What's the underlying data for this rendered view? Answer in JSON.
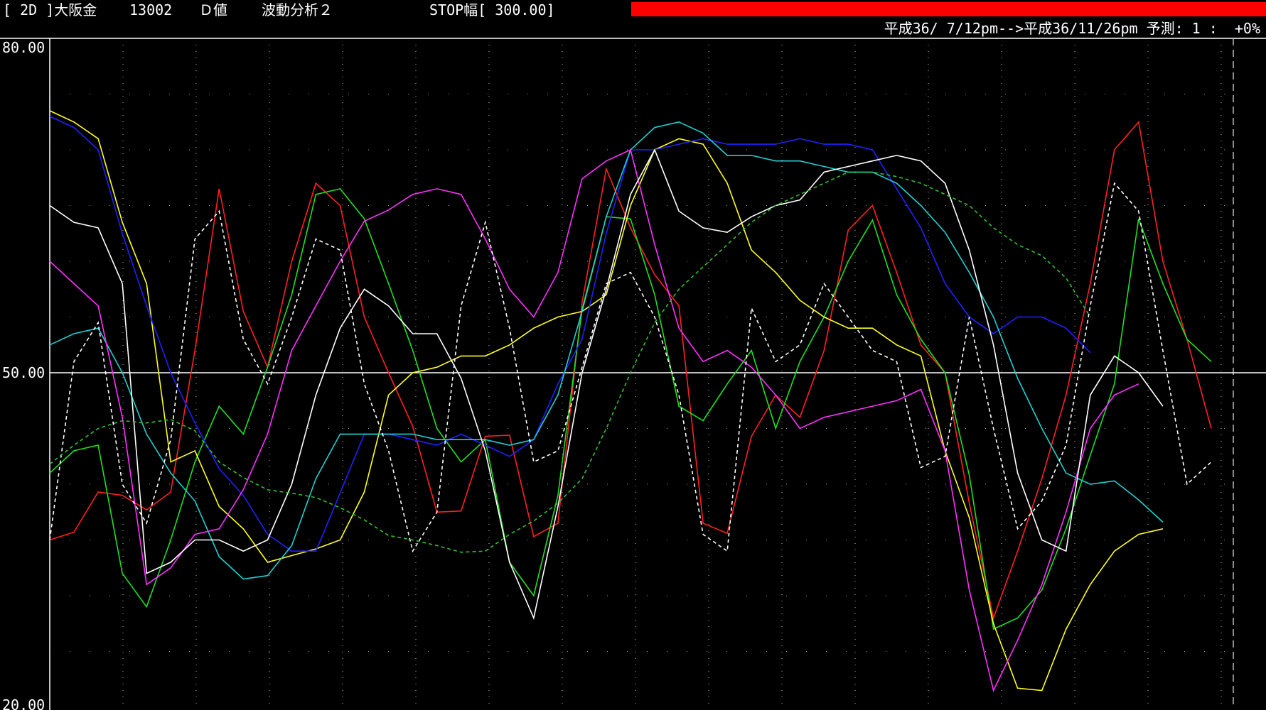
{
  "header": {
    "code_label": "[ 2D ]大阪金",
    "code_number": "13002",
    "mode": "Ｄ値",
    "analysis": "波動分析２",
    "stop_label": "STOP幅[ 300.00]",
    "stop_color": "#ff0000"
  },
  "subheader": {
    "range_text": "平成36/ 7/12pm-->平成36/11/26pm 予測: 1 :  +0%"
  },
  "chart_data": {
    "type": "line",
    "ylim": [
      20,
      80
    ],
    "yticks": [
      "80.00",
      "50.00",
      "20.00"
    ],
    "reference_line": 50,
    "grid": "dotted",
    "n_points": 50,
    "series": [
      {
        "color": "#ff2020",
        "dash": false,
        "values": [
          35,
          35.7,
          39.3,
          39,
          37.7,
          39.3,
          52,
          66.5,
          55.5,
          50.5,
          60,
          67,
          65,
          55,
          50,
          45.2,
          37.5,
          37.6,
          44.3,
          44.4,
          35.3,
          36.5,
          56.3,
          68.3,
          63,
          58.8,
          56,
          36.5,
          35.6,
          44.3,
          48,
          46,
          52,
          62.8,
          65,
          59,
          52.5,
          50,
          38.3,
          28,
          34,
          40.5,
          48,
          58,
          70,
          72.5,
          60,
          53,
          45
        ]
      },
      {
        "color": "#20e020",
        "dash": false,
        "values": [
          41,
          43,
          43.5,
          32,
          29,
          35,
          42,
          47,
          44.5,
          50.5,
          57,
          66,
          66.5,
          63.8,
          58,
          52,
          45,
          42,
          44,
          33,
          30,
          39,
          55.7,
          64,
          63.8,
          57,
          47,
          45.7,
          49,
          52,
          45,
          51,
          55,
          60,
          63.7,
          57,
          53,
          50,
          40.8,
          27,
          28,
          30.5,
          36,
          42.6,
          49,
          63.8,
          58,
          53,
          51
        ]
      },
      {
        "color": "#ffff20",
        "dash": false,
        "values": [
          73.5,
          72.5,
          71,
          63.5,
          58,
          42,
          43,
          38,
          36,
          33,
          33.6,
          34.2,
          35,
          39.3,
          48,
          50,
          50.5,
          51.5,
          51.5,
          52.5,
          54,
          55,
          55.5,
          57,
          65,
          70,
          71,
          70.5,
          67,
          61,
          59,
          56.5,
          55,
          54,
          54,
          52.5,
          51.5,
          43,
          37,
          27.5,
          21.7,
          21.5,
          27,
          31,
          34,
          35.5,
          36
        ]
      },
      {
        "color": "#2020ff",
        "dash": false,
        "values": [
          73,
          72,
          70,
          62.5,
          56,
          50,
          45.5,
          41.4,
          39,
          35.5,
          34,
          34,
          39.2,
          44.5,
          44.5,
          44,
          43.5,
          44.5,
          43.5,
          42.5,
          44,
          49,
          53,
          62.5,
          70,
          70,
          70.5,
          71,
          70.5,
          70.5,
          70.5,
          71,
          70.5,
          70.5,
          70,
          66.5,
          63,
          58,
          55,
          53.5,
          55,
          55,
          54,
          51.8
        ]
      },
      {
        "color": "#20d0d0",
        "dash": false,
        "values": [
          52.5,
          53.5,
          54,
          50,
          44.5,
          41,
          38.5,
          33.5,
          31.5,
          31.8,
          34.5,
          40.5,
          44.5,
          44.5,
          44.5,
          44.5,
          44,
          44,
          44,
          43.5,
          44,
          48,
          55.5,
          64,
          70,
          72,
          72.5,
          71.5,
          69.5,
          69.5,
          69,
          69,
          68.5,
          68,
          68,
          67,
          65,
          62.6,
          59,
          55,
          49.5,
          45,
          41,
          40,
          40.3,
          38.6,
          36.6
        ]
      },
      {
        "color": "#ff30ff",
        "dash": false,
        "values": [
          60,
          58,
          56,
          46,
          31,
          32.5,
          35.5,
          36,
          39.5,
          44.5,
          52,
          56,
          60,
          63.6,
          64.6,
          66,
          66.5,
          66,
          62,
          57.5,
          55,
          59,
          67.4,
          69,
          70,
          61.5,
          54,
          51,
          52,
          50.5,
          48,
          45,
          46,
          46.5,
          47,
          47.5,
          48.5,
          43,
          30.5,
          21.5,
          26,
          31,
          37.5,
          45,
          48,
          49
        ]
      },
      {
        "color": "#ffffff",
        "dash": false,
        "values": [
          65,
          63.5,
          63,
          58,
          32,
          33,
          35,
          35,
          34,
          35,
          40,
          48,
          54,
          57.5,
          56,
          53.5,
          53.5,
          49.5,
          43,
          33,
          28,
          38,
          50,
          57.5,
          66,
          70,
          64.5,
          63,
          62.6,
          64,
          65,
          65.5,
          68,
          68.5,
          69,
          69.5,
          69,
          67,
          61,
          52.5,
          41,
          35,
          34,
          48,
          51.5,
          50,
          47
        ]
      },
      {
        "color": "#ffffff",
        "dash": true,
        "values": [
          35,
          51,
          54.5,
          40,
          36.5,
          44,
          62,
          64.5,
          53,
          49,
          55,
          62,
          61,
          49,
          43,
          34,
          37.5,
          56,
          63.5,
          54,
          42,
          43,
          50.5,
          58,
          59,
          55,
          48,
          35.5,
          34,
          55.8,
          51,
          52.5,
          58,
          55,
          52,
          51,
          41.5,
          42.5,
          55,
          45,
          36,
          38.5,
          43.5,
          56,
          67,
          64.5,
          52,
          40,
          42
        ]
      },
      {
        "color": "#30c030",
        "dash": true,
        "values": [
          41.8,
          43.5,
          45,
          45.7,
          45.5,
          45.8,
          44.8,
          42,
          40.6,
          39.5,
          39.2,
          38.8,
          37.9,
          36.8,
          35.4,
          35,
          34.5,
          33.9,
          34,
          35.5,
          36.7,
          38.3,
          40.5,
          45,
          50,
          54.5,
          57.5,
          59.5,
          61.5,
          63.5,
          65,
          66,
          67,
          68,
          68,
          67.6,
          67,
          66,
          65,
          63,
          61.5,
          60.5,
          58.5,
          55
        ]
      }
    ]
  }
}
